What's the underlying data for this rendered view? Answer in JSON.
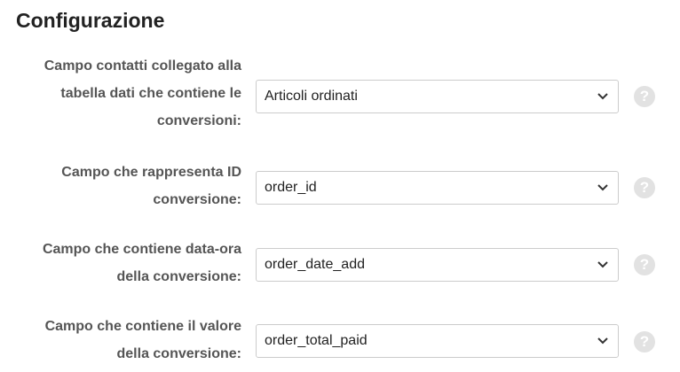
{
  "page": {
    "title": "Configurazione"
  },
  "fields": [
    {
      "label": "Campo contatti collegato alla tabella dati che contiene le conversioni:",
      "value": "Articoli ordinati",
      "help_icon": "question-circle-icon"
    },
    {
      "label": "Campo che rappresenta ID conversione:",
      "value": "order_id",
      "help_icon": "question-circle-icon"
    },
    {
      "label": "Campo che contiene data-ora della conversione:",
      "value": "order_date_add",
      "help_icon": "question-circle-icon"
    },
    {
      "label": "Campo che contiene il valore della conversione:",
      "value": "order_total_paid",
      "help_icon": "question-circle-icon"
    }
  ],
  "help_glyph": "?",
  "colors": {
    "title": "#222222",
    "label": "#555555",
    "select_border": "#cccccc",
    "help_icon_bg": "#e2e2e2"
  }
}
